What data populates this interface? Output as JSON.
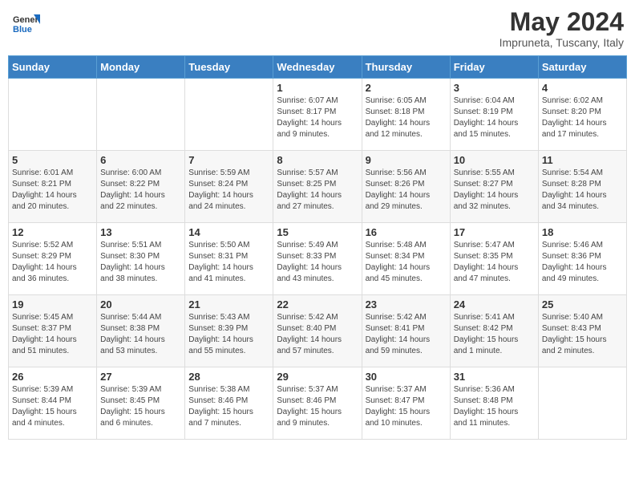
{
  "header": {
    "logo_general": "General",
    "logo_blue": "Blue",
    "month_title": "May 2024",
    "subtitle": "Impruneta, Tuscany, Italy"
  },
  "days_of_week": [
    "Sunday",
    "Monday",
    "Tuesday",
    "Wednesday",
    "Thursday",
    "Friday",
    "Saturday"
  ],
  "weeks": [
    [
      {
        "num": "",
        "info": ""
      },
      {
        "num": "",
        "info": ""
      },
      {
        "num": "",
        "info": ""
      },
      {
        "num": "1",
        "info": "Sunrise: 6:07 AM\nSunset: 8:17 PM\nDaylight: 14 hours\nand 9 minutes."
      },
      {
        "num": "2",
        "info": "Sunrise: 6:05 AM\nSunset: 8:18 PM\nDaylight: 14 hours\nand 12 minutes."
      },
      {
        "num": "3",
        "info": "Sunrise: 6:04 AM\nSunset: 8:19 PM\nDaylight: 14 hours\nand 15 minutes."
      },
      {
        "num": "4",
        "info": "Sunrise: 6:02 AM\nSunset: 8:20 PM\nDaylight: 14 hours\nand 17 minutes."
      }
    ],
    [
      {
        "num": "5",
        "info": "Sunrise: 6:01 AM\nSunset: 8:21 PM\nDaylight: 14 hours\nand 20 minutes."
      },
      {
        "num": "6",
        "info": "Sunrise: 6:00 AM\nSunset: 8:22 PM\nDaylight: 14 hours\nand 22 minutes."
      },
      {
        "num": "7",
        "info": "Sunrise: 5:59 AM\nSunset: 8:24 PM\nDaylight: 14 hours\nand 24 minutes."
      },
      {
        "num": "8",
        "info": "Sunrise: 5:57 AM\nSunset: 8:25 PM\nDaylight: 14 hours\nand 27 minutes."
      },
      {
        "num": "9",
        "info": "Sunrise: 5:56 AM\nSunset: 8:26 PM\nDaylight: 14 hours\nand 29 minutes."
      },
      {
        "num": "10",
        "info": "Sunrise: 5:55 AM\nSunset: 8:27 PM\nDaylight: 14 hours\nand 32 minutes."
      },
      {
        "num": "11",
        "info": "Sunrise: 5:54 AM\nSunset: 8:28 PM\nDaylight: 14 hours\nand 34 minutes."
      }
    ],
    [
      {
        "num": "12",
        "info": "Sunrise: 5:52 AM\nSunset: 8:29 PM\nDaylight: 14 hours\nand 36 minutes."
      },
      {
        "num": "13",
        "info": "Sunrise: 5:51 AM\nSunset: 8:30 PM\nDaylight: 14 hours\nand 38 minutes."
      },
      {
        "num": "14",
        "info": "Sunrise: 5:50 AM\nSunset: 8:31 PM\nDaylight: 14 hours\nand 41 minutes."
      },
      {
        "num": "15",
        "info": "Sunrise: 5:49 AM\nSunset: 8:33 PM\nDaylight: 14 hours\nand 43 minutes."
      },
      {
        "num": "16",
        "info": "Sunrise: 5:48 AM\nSunset: 8:34 PM\nDaylight: 14 hours\nand 45 minutes."
      },
      {
        "num": "17",
        "info": "Sunrise: 5:47 AM\nSunset: 8:35 PM\nDaylight: 14 hours\nand 47 minutes."
      },
      {
        "num": "18",
        "info": "Sunrise: 5:46 AM\nSunset: 8:36 PM\nDaylight: 14 hours\nand 49 minutes."
      }
    ],
    [
      {
        "num": "19",
        "info": "Sunrise: 5:45 AM\nSunset: 8:37 PM\nDaylight: 14 hours\nand 51 minutes."
      },
      {
        "num": "20",
        "info": "Sunrise: 5:44 AM\nSunset: 8:38 PM\nDaylight: 14 hours\nand 53 minutes."
      },
      {
        "num": "21",
        "info": "Sunrise: 5:43 AM\nSunset: 8:39 PM\nDaylight: 14 hours\nand 55 minutes."
      },
      {
        "num": "22",
        "info": "Sunrise: 5:42 AM\nSunset: 8:40 PM\nDaylight: 14 hours\nand 57 minutes."
      },
      {
        "num": "23",
        "info": "Sunrise: 5:42 AM\nSunset: 8:41 PM\nDaylight: 14 hours\nand 59 minutes."
      },
      {
        "num": "24",
        "info": "Sunrise: 5:41 AM\nSunset: 8:42 PM\nDaylight: 15 hours\nand 1 minute."
      },
      {
        "num": "25",
        "info": "Sunrise: 5:40 AM\nSunset: 8:43 PM\nDaylight: 15 hours\nand 2 minutes."
      }
    ],
    [
      {
        "num": "26",
        "info": "Sunrise: 5:39 AM\nSunset: 8:44 PM\nDaylight: 15 hours\nand 4 minutes."
      },
      {
        "num": "27",
        "info": "Sunrise: 5:39 AM\nSunset: 8:45 PM\nDaylight: 15 hours\nand 6 minutes."
      },
      {
        "num": "28",
        "info": "Sunrise: 5:38 AM\nSunset: 8:46 PM\nDaylight: 15 hours\nand 7 minutes."
      },
      {
        "num": "29",
        "info": "Sunrise: 5:37 AM\nSunset: 8:46 PM\nDaylight: 15 hours\nand 9 minutes."
      },
      {
        "num": "30",
        "info": "Sunrise: 5:37 AM\nSunset: 8:47 PM\nDaylight: 15 hours\nand 10 minutes."
      },
      {
        "num": "31",
        "info": "Sunrise: 5:36 AM\nSunset: 8:48 PM\nDaylight: 15 hours\nand 11 minutes."
      },
      {
        "num": "",
        "info": ""
      }
    ]
  ]
}
